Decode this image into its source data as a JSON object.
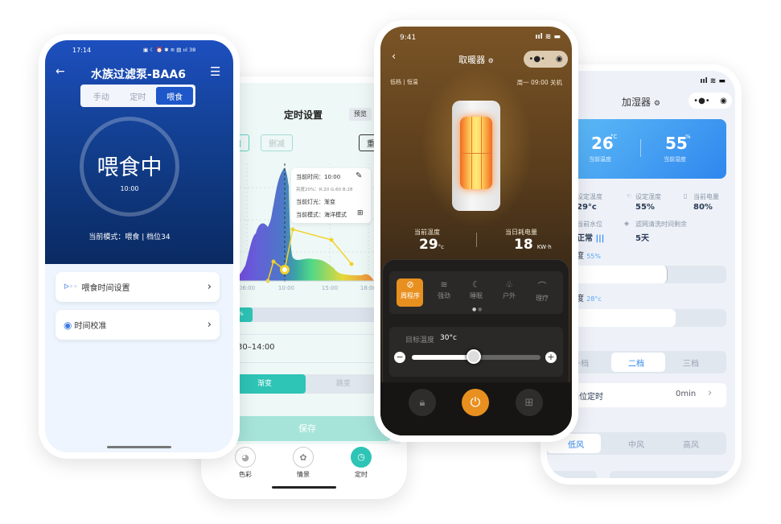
{
  "aquarium": {
    "status_time": "17:14",
    "status_icons": "▣ ☾ ⏰ ✱ ≋ ▤ ııl 38",
    "title": "水族过滤泵-BAA6",
    "tabs": [
      {
        "label": "手动"
      },
      {
        "label": "定时"
      },
      {
        "label": "喂食",
        "active": true
      }
    ],
    "state": "喂食中",
    "time": "10:00",
    "mode_line": "当前模式：喂食 | 档位34",
    "menu": [
      {
        "label": "喂食时间设置",
        "icon": "fish-icon"
      },
      {
        "label": "时间校准",
        "icon": "target-icon"
      }
    ]
  },
  "timer": {
    "title": "定时设置",
    "preview": "预览",
    "add": "加",
    "remove": "删减",
    "reset": "重",
    "chart_ticks": [
      "06:00",
      "10:00",
      "15:00",
      "18:00"
    ],
    "tooltip": {
      "time": "当前时间：10:00",
      "rgb": "亮度20%：R:20  G:60  B:28",
      "light": "当前灯光：渐变",
      "mode": "当前模式：海洋模式"
    },
    "progress_label": "%",
    "range": "30–14:00",
    "transition": [
      {
        "label": "渐变",
        "active": true
      },
      {
        "label": "跳变"
      }
    ],
    "save": "保存",
    "nav": [
      {
        "label": "色彩"
      },
      {
        "label": "情景"
      },
      {
        "label": "定时",
        "active": true
      }
    ],
    "accent": "#2ec4b6"
  },
  "heater": {
    "status_time": "9:41",
    "title": "取暖器",
    "mode_info": "低档 | 恒温",
    "schedule": "周一  09:00  关机",
    "current_temp_label": "当前温度",
    "current_temp": "29",
    "temp_unit": "°c",
    "energy_label": "当日耗电量",
    "energy": "18",
    "energy_unit": "KW·h",
    "modes": [
      {
        "label": "周程序",
        "icon": "clock-icon",
        "active": true
      },
      {
        "label": "强劲",
        "icon": "heat-icon"
      },
      {
        "label": "睡眠",
        "icon": "moon-icon"
      },
      {
        "label": "户外",
        "icon": "outdoor-icon"
      },
      {
        "label": "理疗",
        "icon": "therapy-icon"
      }
    ],
    "target_label": "目标温度",
    "target_value": "30°c",
    "target_fraction": 0.48,
    "accent": "#e8901f"
  },
  "humidifier": {
    "title": "加湿器",
    "temp": "26",
    "temp_unit": "°C",
    "temp_label": "当前温度",
    "humidity": "55",
    "humidity_unit": "%",
    "humidity_label": "当前湿度",
    "stats": [
      {
        "label": "设定温度",
        "value": "29°c"
      },
      {
        "label": "设定湿度",
        "value": "55%"
      },
      {
        "label": "当前电量",
        "value": "80%"
      },
      {
        "label": "当前水位",
        "value": "正常"
      },
      {
        "label": "滤网清洗时间剩余",
        "value": "5天"
      }
    ],
    "humidity_slider_label": "湿度",
    "humidity_slider_value": "55%",
    "temp_slider_label": "温度",
    "temp_slider_value": "28°c",
    "gears": [
      {
        "label": "一档"
      },
      {
        "label": "二档",
        "active": true
      },
      {
        "label": "三档"
      }
    ],
    "gear_timer_label": "档位定时",
    "gear_timer_value": "0min",
    "wind": [
      {
        "label": "低风",
        "active": true
      },
      {
        "label": "中风"
      },
      {
        "label": "高风"
      }
    ],
    "accent": "#2f86ee"
  }
}
